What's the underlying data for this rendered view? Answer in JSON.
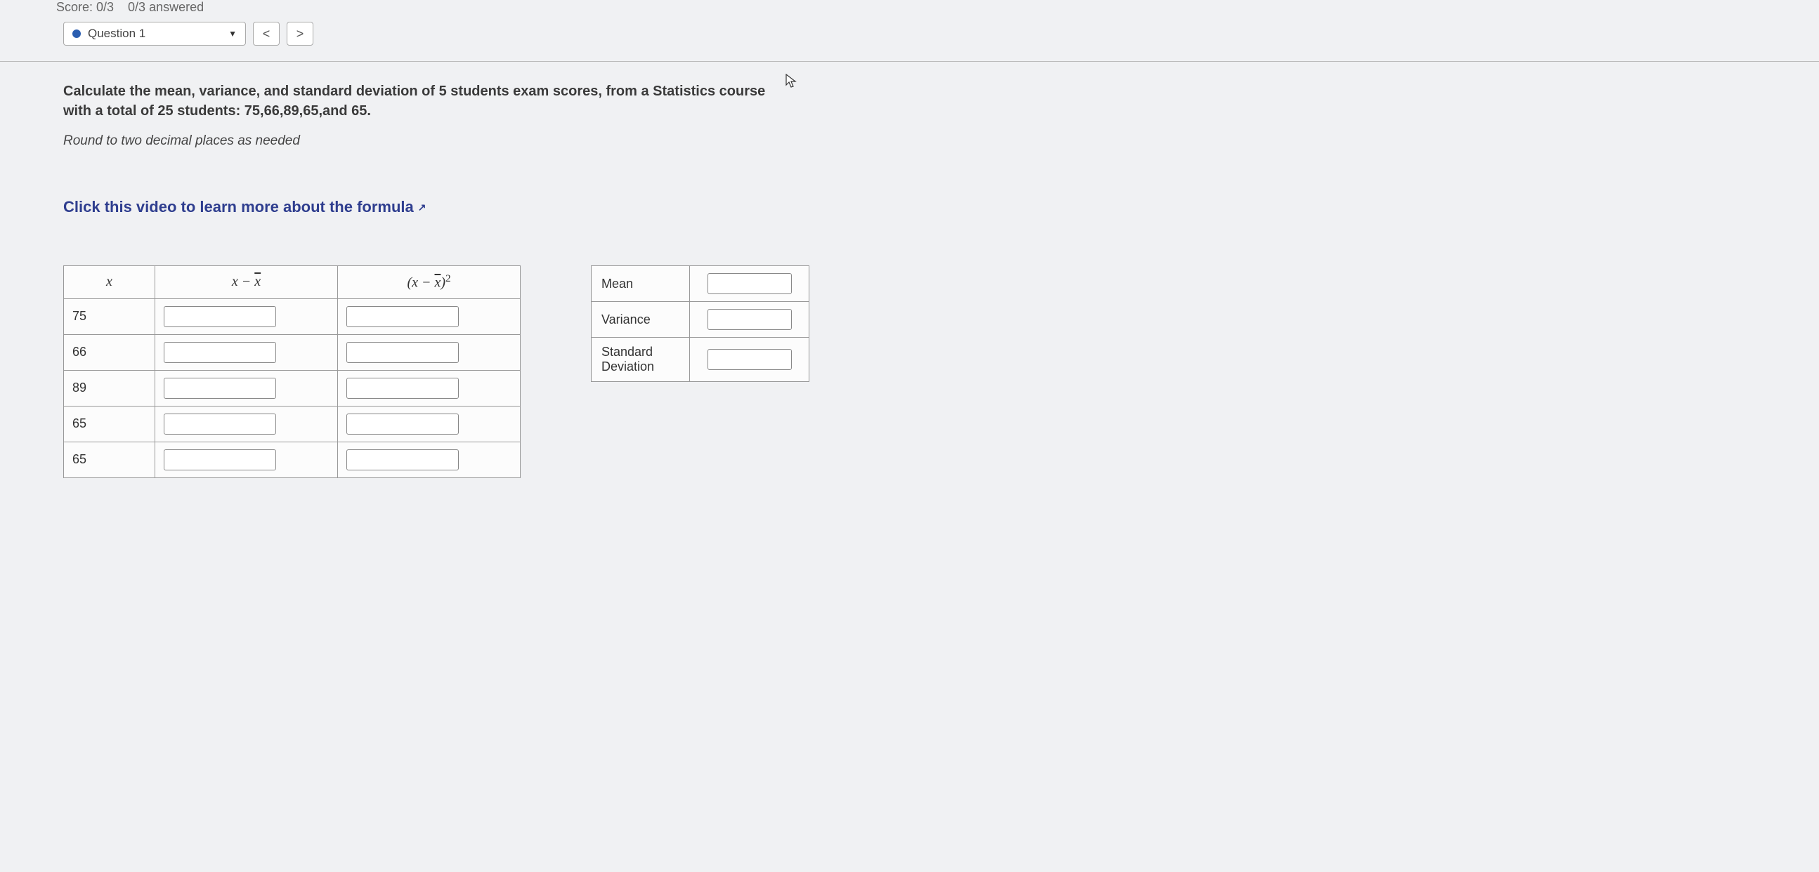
{
  "header": {
    "score_label": "Score: 0/3",
    "answered_label": "0/3 answered",
    "question_label": "Question 1"
  },
  "question": {
    "prompt": "Calculate the mean, variance, and standard deviation of 5 students exam scores, from a Statistics course with a total of 25 students: 75,66,89,65,and 65.",
    "hint": "Round to two decimal places as needed",
    "video_link": "Click this video to learn more about the formula"
  },
  "data_table": {
    "header_x": "x",
    "header_dev": "x − x̄",
    "header_sq": "(x − x̄)²",
    "rows": [
      {
        "x": "75"
      },
      {
        "x": "66"
      },
      {
        "x": "89"
      },
      {
        "x": "65"
      },
      {
        "x": "65"
      }
    ]
  },
  "stats_table": {
    "mean_label": "Mean",
    "variance_label": "Variance",
    "stddev_label": "Standard Deviation"
  }
}
